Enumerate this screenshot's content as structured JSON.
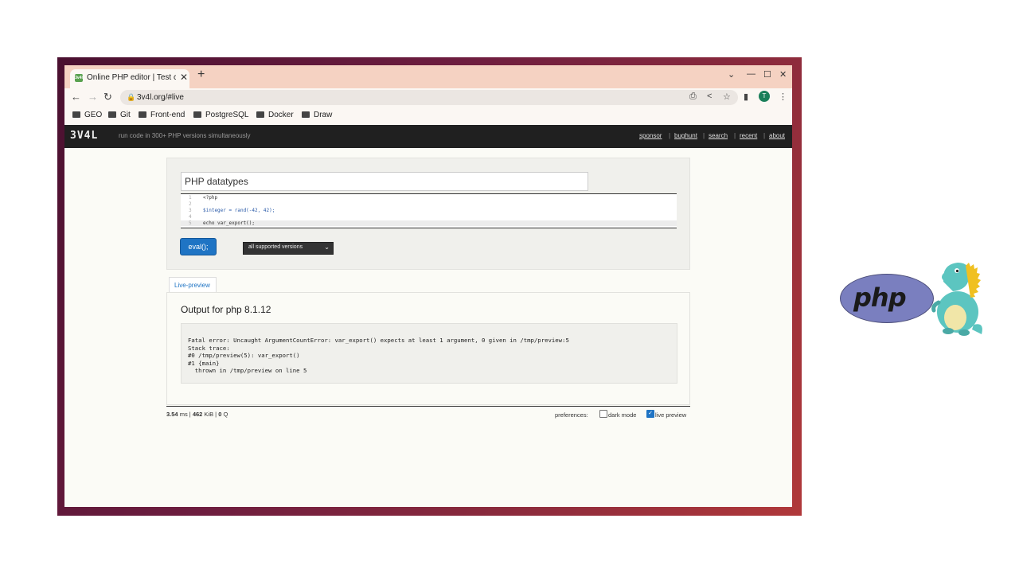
{
  "browser": {
    "tab_title": "Online PHP editor | Test c",
    "favicon_text": "3v4l",
    "url": "3v4l.org/#live",
    "avatar_letter": "T",
    "bookmarks": [
      "GEO",
      "Git",
      "Front-end",
      "PostgreSQL",
      "Docker",
      "Draw"
    ]
  },
  "site": {
    "logo": "3V4L",
    "tagline": "run code in 300+ PHP versions simultaneously",
    "nav": [
      "sponsor",
      "bughunt",
      "search",
      "recent",
      "about"
    ],
    "nav_separator": "|"
  },
  "editor": {
    "title": "PHP datatypes",
    "lines": [
      {
        "n": "1",
        "text": "<?php"
      },
      {
        "n": "2",
        "text": ""
      },
      {
        "n": "3",
        "text": "$integer = rand(-42, 42);"
      },
      {
        "n": "4",
        "text": ""
      },
      {
        "n": "5",
        "text": "echo var_export();"
      }
    ],
    "eval_label": "eval();",
    "version_select": "all supported versions"
  },
  "preview": {
    "tab_label": "Live-preview",
    "output_title": "Output for php 8.1.12",
    "output_text": "Fatal error: Uncaught ArgumentCountError: var_export() expects at least 1 argument, 0 given in /tmp/preview:5\nStack trace:\n#0 /tmp/preview(5): var_export()\n#1 {main}\n  thrown in /tmp/preview on line 5"
  },
  "footer": {
    "time_value": "3.54",
    "time_unit": " ms | ",
    "memory_value": "462",
    "memory_unit": " KiB | ",
    "queries_value": "0",
    "queries_unit": " Q",
    "preferences_label": "preferences:",
    "dark_mode_label": "dark mode",
    "dark_mode_checked": false,
    "live_preview_label": "live preview",
    "live_preview_checked": true
  },
  "overlay": {
    "php_logo_text": "php"
  },
  "colors": {
    "accent": "#1f74c4",
    "header_bg": "#202020",
    "tab_strip": "#f5d2c2"
  }
}
